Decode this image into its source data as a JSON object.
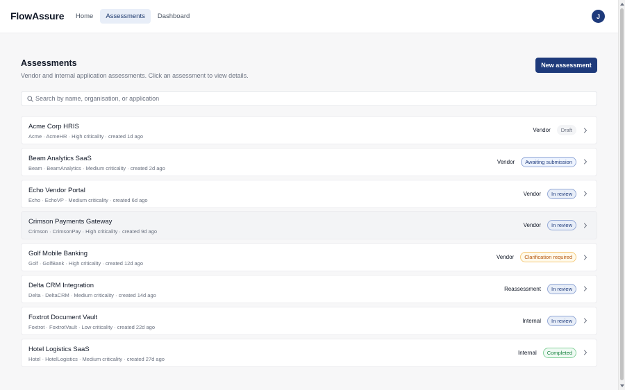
{
  "app": {
    "brand": "FlowAssure",
    "avatar_initial": "J"
  },
  "nav": [
    {
      "label": "Home",
      "active": false
    },
    {
      "label": "Assessments",
      "active": true
    },
    {
      "label": "Dashboard",
      "active": false
    }
  ],
  "page": {
    "title": "Assessments",
    "subtitle": "Vendor and internal application assessments. Click an assessment to view details.",
    "new_button": "New assessment"
  },
  "search": {
    "placeholder": "Search by name, organisation, or application",
    "value": ""
  },
  "status_colors": {
    "Draft": {
      "bg": "#f3f4f6",
      "border": "#f3f4f6",
      "text": "#6b7280"
    },
    "Awaiting submission": {
      "bg": "#eef4ff",
      "border": "#93a8d6",
      "text": "#1e3a7b"
    },
    "In review": {
      "bg": "#e8eef8",
      "border": "#93a8d6",
      "text": "#1e3a7b"
    },
    "Clarification required": {
      "bg": "#fffaeb",
      "border": "#f5c97a",
      "text": "#b45309"
    },
    "Completed": {
      "bg": "#effaf3",
      "border": "#86d19c",
      "text": "#15803d"
    }
  },
  "assessments": [
    {
      "title": "Acme Corp HRIS",
      "meta": "Acme · AcmeHR · High criticality · created 1d ago",
      "type": "Vendor",
      "status": "Draft"
    },
    {
      "title": "Beam Analytics SaaS",
      "meta": "Beam · BeamAnalytics · Medium criticality · created 2d ago",
      "type": "Vendor",
      "status": "Awaiting submission"
    },
    {
      "title": "Echo Vendor Portal",
      "meta": "Echo · EchoVP · Medium criticality · created 6d ago",
      "type": "Vendor",
      "status": "In review"
    },
    {
      "title": "Crimson Payments Gateway",
      "meta": "Crimson · CrimsonPay · High criticality · created 9d ago",
      "type": "Vendor",
      "status": "In review",
      "hover": true
    },
    {
      "title": "Golf Mobile Banking",
      "meta": "Golf · GolfBank · High criticality · created 12d ago",
      "type": "Vendor",
      "status": "Clarification required"
    },
    {
      "title": "Delta CRM Integration",
      "meta": "Delta · DeltaCRM · Medium criticality · created 14d ago",
      "type": "Reassessment",
      "status": "In review"
    },
    {
      "title": "Foxtrot Document Vault",
      "meta": "Foxtrot · FoxtrotVault · Low criticality · created 22d ago",
      "type": "Internal",
      "status": "In review"
    },
    {
      "title": "Hotel Logistics SaaS",
      "meta": "Hotel · HotelLogistics · Medium criticality · created 27d ago",
      "type": "Internal",
      "status": "Completed"
    }
  ]
}
